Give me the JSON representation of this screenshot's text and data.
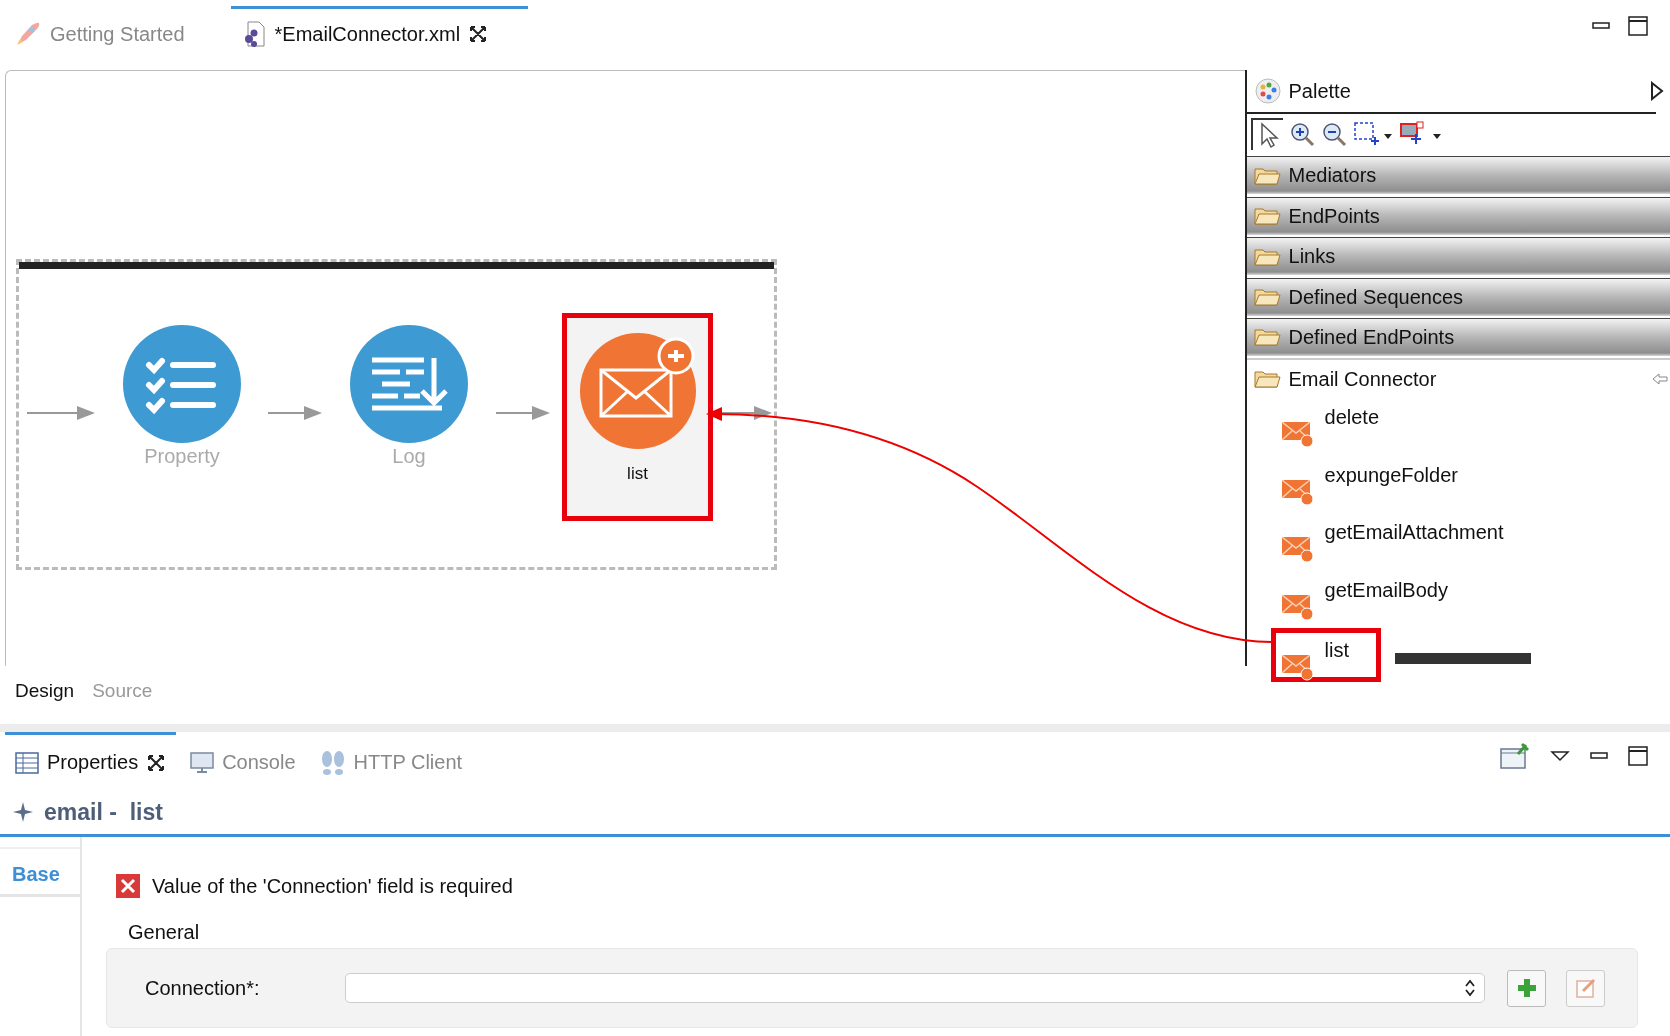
{
  "editor_tabs": [
    {
      "label": "Getting Started",
      "kind": "welcome",
      "selected": false,
      "closable": false
    },
    {
      "label": "*EmailConnector.xml",
      "kind": "file",
      "selected": true,
      "closable": true
    }
  ],
  "diagram": {
    "nodes": [
      {
        "kind": "property",
        "label": "Property",
        "selected": false
      },
      {
        "kind": "log",
        "label": "Log",
        "selected": false
      },
      {
        "kind": "connector",
        "label": "list",
        "selected": true
      }
    ]
  },
  "palette": {
    "title": "Palette",
    "drawers": [
      {
        "label": "Mediators",
        "expanded": false
      },
      {
        "label": "EndPoints",
        "expanded": false
      },
      {
        "label": "Links",
        "expanded": false
      },
      {
        "label": "Defined Sequences",
        "expanded": false
      },
      {
        "label": "Defined EndPoints",
        "expanded": false
      },
      {
        "label": "Email Connector",
        "expanded": true,
        "items": [
          {
            "label": "delete",
            "highlighted": false
          },
          {
            "label": "expungeFolder",
            "highlighted": false
          },
          {
            "label": "getEmailAttachment",
            "highlighted": false
          },
          {
            "label": "getEmailBody",
            "highlighted": false
          },
          {
            "label": "list",
            "highlighted": true
          }
        ]
      }
    ]
  },
  "editor_modes": [
    {
      "label": "Design",
      "selected": true
    },
    {
      "label": "Source",
      "selected": false
    }
  ],
  "view_tabs": [
    {
      "label": "Properties",
      "kind": "properties",
      "selected": true,
      "closable": true
    },
    {
      "label": "Console",
      "kind": "console",
      "selected": false,
      "closable": false
    },
    {
      "label": "HTTP Client",
      "kind": "http",
      "selected": false,
      "closable": false
    }
  ],
  "properties": {
    "title": "email -  list",
    "side_tabs": [
      {
        "label": "Base",
        "selected": true
      }
    ],
    "error": "Value of the 'Connection' field is required",
    "section": "General",
    "fields": [
      {
        "label": "Connection*:"
      }
    ]
  }
}
